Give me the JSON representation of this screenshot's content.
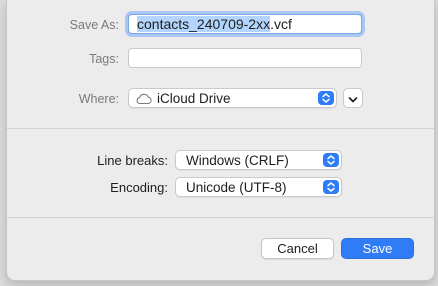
{
  "save_as": {
    "label": "Save As:",
    "value_selected": "contacts_240709-2xx",
    "value_extension": ".vcf"
  },
  "tags": {
    "label": "Tags:",
    "value": ""
  },
  "where": {
    "label": "Where:",
    "location": "iCloud Drive",
    "location_icon": "cloud-icon",
    "expand_icon": "chevron-down-icon"
  },
  "options": {
    "line_breaks": {
      "label": "Line breaks:",
      "selected": "Windows (CRLF)"
    },
    "encoding": {
      "label": "Encoding:",
      "selected": "Unicode (UTF-8)"
    }
  },
  "buttons": {
    "cancel": "Cancel",
    "save": "Save"
  },
  "colors": {
    "accent": "#2f7cf6",
    "selection": "#b3d4fc",
    "sheet_background": "#ececec"
  }
}
